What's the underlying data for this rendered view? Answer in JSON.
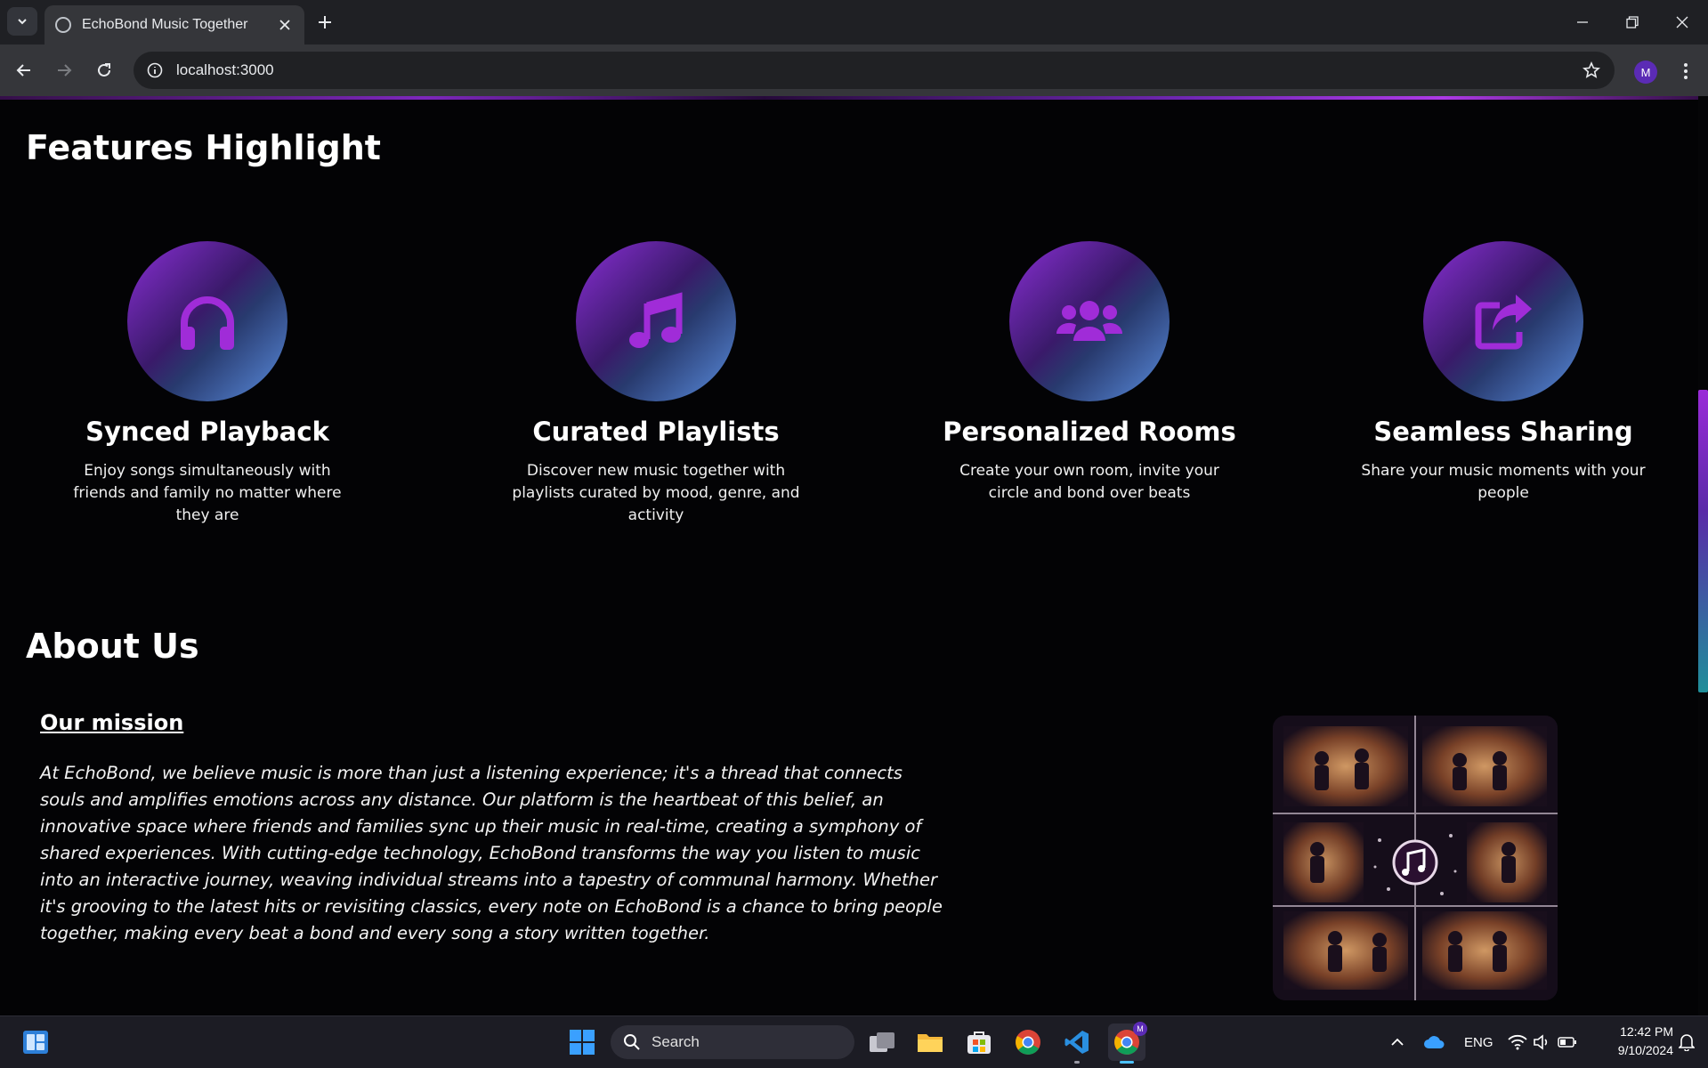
{
  "browser": {
    "tab_title": "EchoBond Music Together",
    "url": "localhost:3000",
    "profile_initial": "M"
  },
  "features": {
    "title": "Features Highlight",
    "items": [
      {
        "icon": "headphones-icon",
        "title": "Synced Playback",
        "description": "Enjoy songs simultaneously with friends and family no matter where they are"
      },
      {
        "icon": "music-note-icon",
        "title": "Curated Playlists",
        "description": "Discover new music together with playlists curated by mood, genre, and activity"
      },
      {
        "icon": "users-icon",
        "title": "Personalized Rooms",
        "description": "Create your own room, invite your circle and bond over beats"
      },
      {
        "icon": "share-icon",
        "title": "Seamless Sharing",
        "description": "Share your music moments with your people"
      }
    ]
  },
  "about": {
    "title": "About Us",
    "mission_heading": "Our mission",
    "mission_text": "At EchoBond, we believe music is more than just a listening experience; it's a thread that connects souls and amplifies emotions across any distance. Our platform is the heartbeat of this belief, an innovative space where friends and families sync up their music in real-time, creating a symphony of shared experiences. With cutting-edge technology, EchoBond transforms the way you listen to music into an interactive journey, weaving individual streams into a tapestry of communal harmony. Whether it's grooving to the latest hits or revisiting classics, every note on EchoBond is a chance to bring people together, making every beat a bond and every song a story written together."
  },
  "taskbar": {
    "search_label": "Search",
    "language": "ENG",
    "time": "12:42 PM",
    "date": "9/10/2024",
    "badge_initial": "M"
  },
  "colors": {
    "accent_purple": "#a02cd8",
    "gradient_blue": "#5b8ee0",
    "page_background": "#030305"
  }
}
